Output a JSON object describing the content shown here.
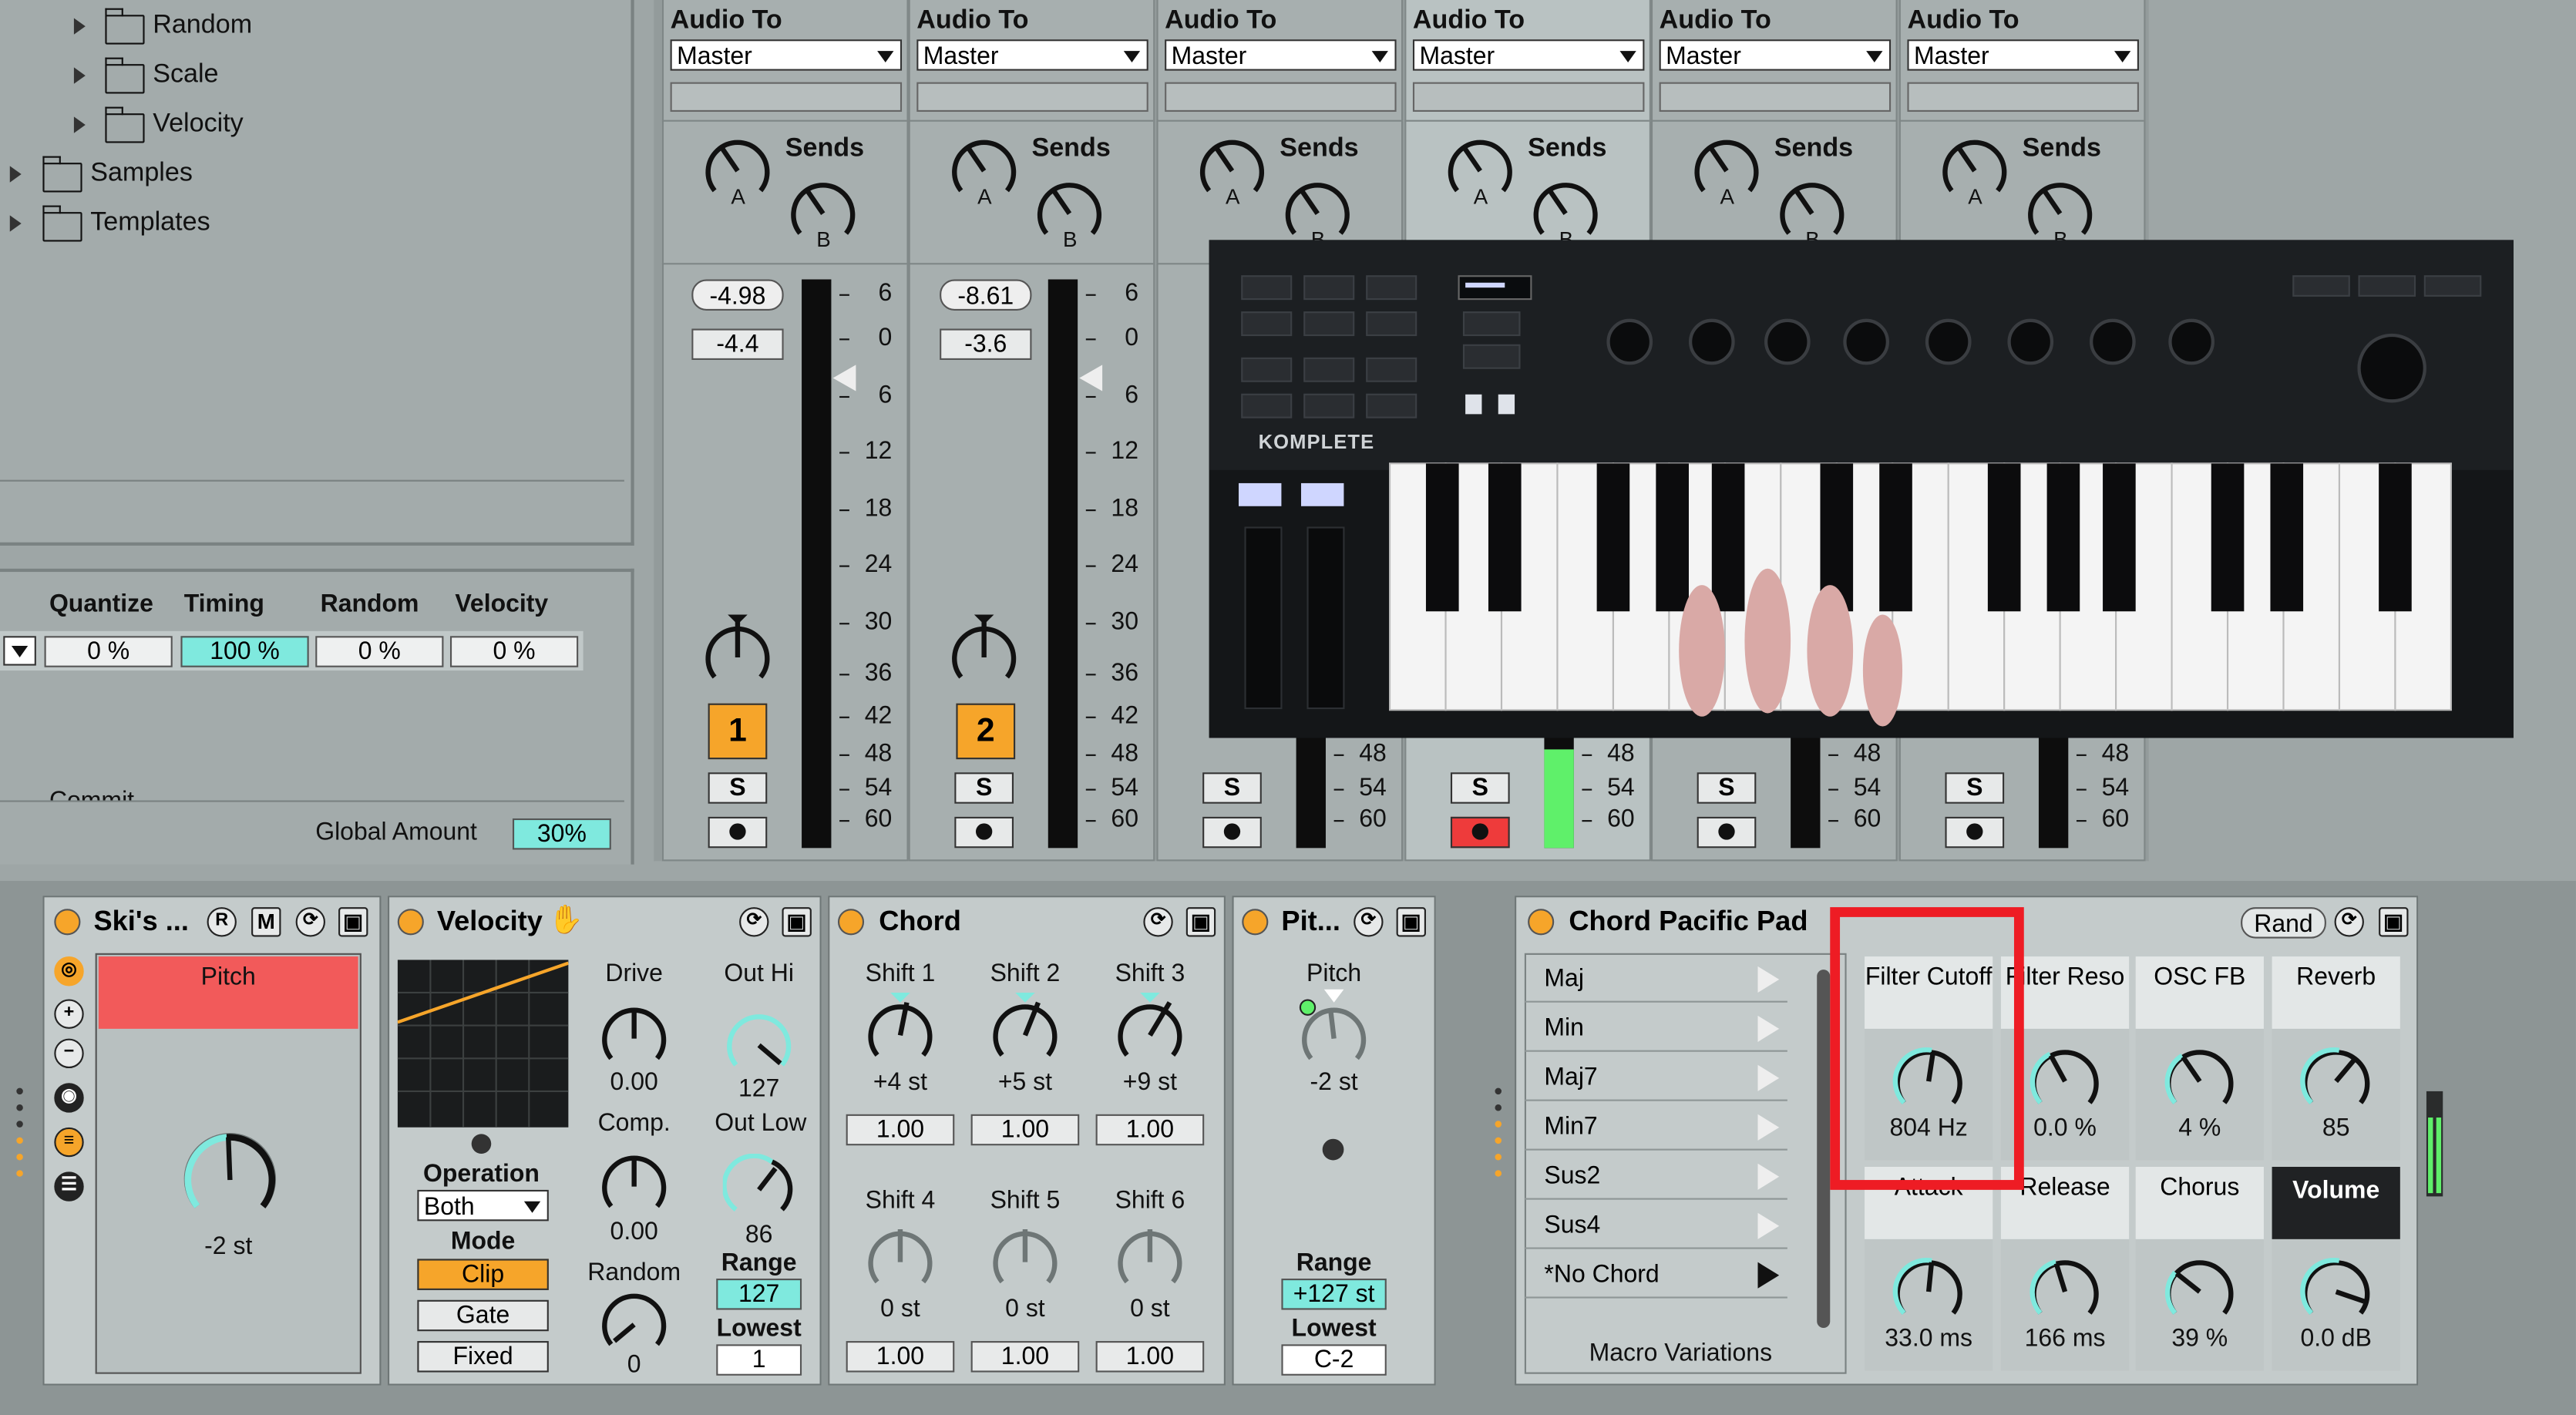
{
  "browser": {
    "items": [
      {
        "label": "Random"
      },
      {
        "label": "Scale"
      },
      {
        "label": "Velocity"
      },
      {
        "label": "Samples"
      },
      {
        "label": "Templates"
      }
    ]
  },
  "groove": {
    "headers": [
      "Quantize",
      "Timing",
      "Random",
      "Velocity"
    ],
    "values": [
      "0 %",
      "100 %",
      "0 %",
      "0 %"
    ],
    "global_amount_label": "Global Amount",
    "global_amount_value": "30%",
    "partial_label": "Commit"
  },
  "mixer": {
    "audio_to_label": "Audio To",
    "output": "Master",
    "sends_label": "Sends",
    "send_a": "A",
    "send_b": "B",
    "solo_label": "S",
    "meter_ticks": [
      "6",
      "0",
      "6",
      "12",
      "18",
      "24",
      "30",
      "36",
      "42",
      "48",
      "54",
      "60"
    ],
    "meter_ticks_lower": [
      "48",
      "54",
      "60"
    ],
    "tracks": [
      {
        "number": "1",
        "peak": "-4.98",
        "volume": "-4.4"
      },
      {
        "number": "2",
        "peak": "-8.61",
        "volume": "-3.6"
      }
    ]
  },
  "video_overlay": {
    "brand": "KOMPLETE"
  },
  "devices": {
    "ski": {
      "title": "Ski's ...",
      "btn_r": "R",
      "btn_m": "M",
      "macro_label": "Pitch",
      "macro_value": "-2 st"
    },
    "velocity": {
      "title": "Velocity",
      "drive_label": "Drive",
      "drive_value": "0.00",
      "comp_label": "Comp.",
      "comp_value": "0.00",
      "random_label": "Random",
      "random_value": "0",
      "out_hi_label": "Out Hi",
      "out_hi_value": "127",
      "out_low_label": "Out Low",
      "out_low_value": "86",
      "operation_label": "Operation",
      "operation_value": "Both",
      "mode_label": "Mode",
      "mode_options": [
        "Clip",
        "Gate",
        "Fixed"
      ],
      "range_label": "Range",
      "range_value": "127",
      "lowest_label": "Lowest",
      "lowest_value": "1"
    },
    "chord": {
      "title": "Chord",
      "shifts": [
        {
          "label": "Shift 1",
          "value": "+4 st",
          "vel": "1.00"
        },
        {
          "label": "Shift 2",
          "value": "+5 st",
          "vel": "1.00"
        },
        {
          "label": "Shift 3",
          "value": "+9 st",
          "vel": "1.00"
        },
        {
          "label": "Shift 4",
          "value": "0 st",
          "vel": "1.00"
        },
        {
          "label": "Shift 5",
          "value": "0 st",
          "vel": "1.00"
        },
        {
          "label": "Shift 6",
          "value": "0 st",
          "vel": "1.00"
        }
      ]
    },
    "pitch": {
      "title": "Pit...",
      "pitch_label": "Pitch",
      "pitch_value": "-2 st",
      "range_label": "Range",
      "range_value": "+127 st",
      "lowest_label": "Lowest",
      "lowest_value": "C-2"
    },
    "rack": {
      "title": "Chord Pacific Pad",
      "rand_label": "Rand",
      "variations": [
        "Maj",
        "Min",
        "Maj7",
        "Min7",
        "Sus2",
        "Sus4",
        "*No Chord"
      ],
      "variations_label": "Macro Variations",
      "macros": [
        {
          "label": "Filter Cutoff",
          "value": "804 Hz"
        },
        {
          "label": "Filter Reso",
          "value": "0.0 %"
        },
        {
          "label": "OSC FB",
          "value": "4 %"
        },
        {
          "label": "Reverb",
          "value": "85"
        },
        {
          "label": "Attack",
          "value": "33.0 ms"
        },
        {
          "label": "Release",
          "value": "166 ms"
        },
        {
          "label": "Chorus",
          "value": "39 %"
        },
        {
          "label": "Volume",
          "value": "0.0 dB"
        }
      ]
    }
  },
  "colors": {
    "accent_orange": "#f6a52a",
    "accent_cyan": "#7fe9de",
    "highlight_red": "#ee1c24",
    "pitch_red": "#f25a5a"
  }
}
